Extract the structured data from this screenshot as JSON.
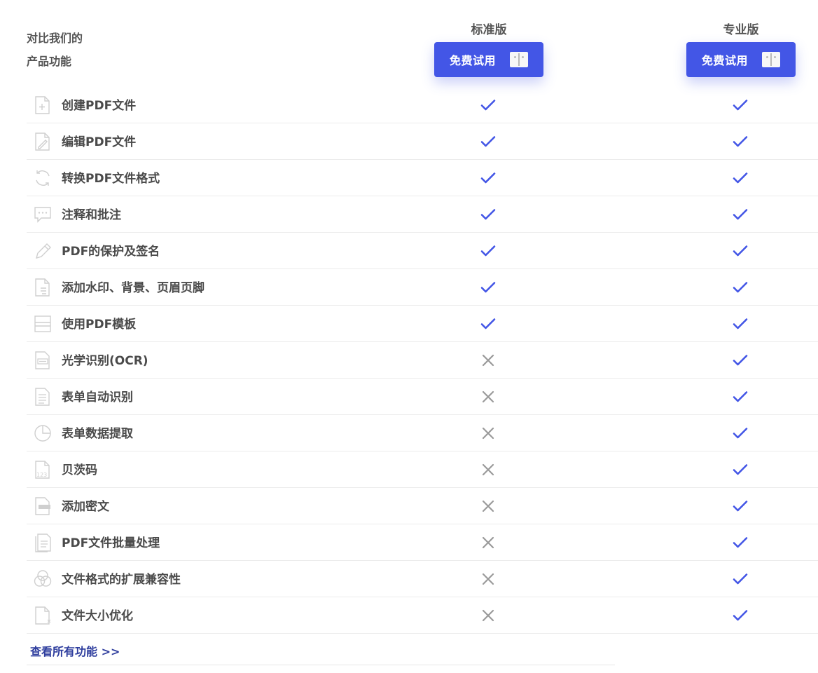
{
  "intro": {
    "line1": "对比我们的",
    "line2": "产品功能"
  },
  "plans": [
    {
      "name": "标准版",
      "button_label": "免费试用"
    },
    {
      "name": "专业版",
      "button_label": "免费试用"
    }
  ],
  "features": [
    {
      "label": "创建PDF文件",
      "icon": "create-file-icon",
      "standard": true,
      "pro": true
    },
    {
      "label": "编辑PDF文件",
      "icon": "edit-file-icon",
      "standard": true,
      "pro": true
    },
    {
      "label": "转换PDF文件格式",
      "icon": "convert-icon",
      "standard": true,
      "pro": true
    },
    {
      "label": "注释和批注",
      "icon": "comment-icon",
      "standard": true,
      "pro": true
    },
    {
      "label": "PDF的保护及签名",
      "icon": "pen-icon",
      "standard": true,
      "pro": true
    },
    {
      "label": "添加水印、背景、页眉页脚",
      "icon": "watermark-icon",
      "standard": true,
      "pro": true
    },
    {
      "label": "使用PDF模板",
      "icon": "template-icon",
      "standard": true,
      "pro": true
    },
    {
      "label": "光学识别(OCR)",
      "icon": "ocr-icon",
      "standard": false,
      "pro": true
    },
    {
      "label": "表单自动识别",
      "icon": "form-icon",
      "standard": false,
      "pro": true
    },
    {
      "label": "表单数据提取",
      "icon": "pie-chart-icon",
      "standard": false,
      "pro": true
    },
    {
      "label": "贝茨码",
      "icon": "bates-number-icon",
      "standard": false,
      "pro": true
    },
    {
      "label": "添加密文",
      "icon": "redact-icon",
      "standard": false,
      "pro": true
    },
    {
      "label": "PDF文件批量处理",
      "icon": "batch-icon",
      "standard": false,
      "pro": true
    },
    {
      "label": "文件格式的扩展兼容性",
      "icon": "compatibility-icon",
      "standard": false,
      "pro": true
    },
    {
      "label": "文件大小优化",
      "icon": "optimize-icon",
      "standard": false,
      "pro": true
    }
  ],
  "bates_icon_text": "123",
  "view_all_label": "查看所有功能 >>",
  "colors": {
    "accent": "#4356e6",
    "check": "#4356e6",
    "cross": "#9a9a9a",
    "link": "#2f3e9e"
  }
}
